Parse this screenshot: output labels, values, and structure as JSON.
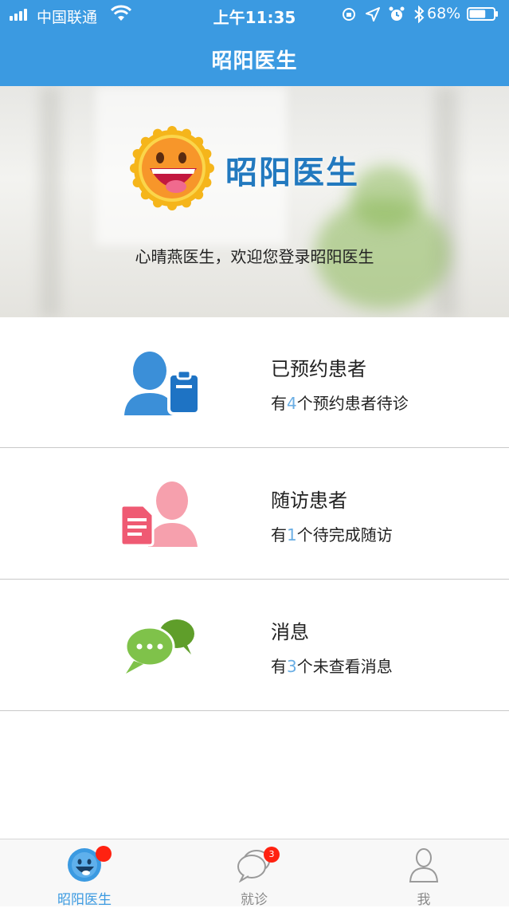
{
  "status_bar": {
    "carrier": "中国联通",
    "time": "上午11:35",
    "battery": "68%",
    "battery_level": 0.68,
    "signal_bars": 4
  },
  "nav": {
    "title": "昭阳医生"
  },
  "hero": {
    "brand": "昭阳医生",
    "welcome": "心晴燕医生，欢迎您登录昭阳医生"
  },
  "cards": [
    {
      "title": "已预约患者",
      "prefix": "有",
      "count": "4",
      "suffix": "个预约患者待诊",
      "icon": "user-clipboard-icon",
      "color": "#3b8fd8"
    },
    {
      "title": "随访患者",
      "prefix": "有",
      "count": "1",
      "suffix": "个待完成随访",
      "icon": "user-document-icon",
      "color": "#ef5a73"
    },
    {
      "title": "消息",
      "prefix": "有",
      "count": "3",
      "suffix": "个未查看消息",
      "icon": "chat-bubbles-icon",
      "color": "#6eb33f"
    }
  ],
  "tabbar": {
    "tabs": [
      {
        "label": "昭阳医生",
        "icon": "sun-logo-icon",
        "active": true,
        "badge": ""
      },
      {
        "label": "就诊",
        "icon": "chat-icon",
        "active": false,
        "badge": "3"
      },
      {
        "label": "我",
        "icon": "person-icon",
        "active": false,
        "badge": ""
      }
    ]
  },
  "colors": {
    "primary": "#3b9ae1",
    "brand_text": "#2279bf",
    "count_highlight": "#6aaee4",
    "badge": "#ff2211"
  }
}
